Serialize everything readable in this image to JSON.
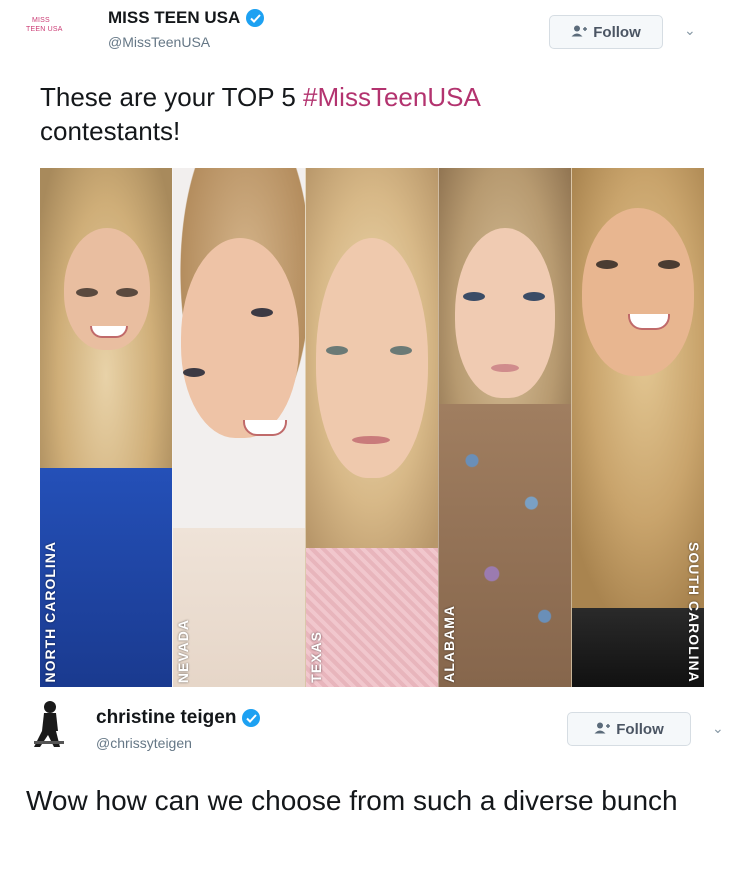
{
  "tweet1": {
    "logo_text": "MISS TEEN USA",
    "display_name": "MISS TEEN USA",
    "handle": "@MissTeenUSA",
    "follow_label": "Follow",
    "text_prefix": "These are your TOP 5 ",
    "hashtag": "#MissTeenUSA",
    "text_suffix": "contestants!"
  },
  "collage": {
    "panels": [
      {
        "state": "NORTH CAROLINA"
      },
      {
        "state": "NEVADA"
      },
      {
        "state": "TEXAS"
      },
      {
        "state": "ALABAMA"
      },
      {
        "state": "SOUTH CAROLINA"
      }
    ]
  },
  "tweet2": {
    "display_name": "christine teigen",
    "handle": "@chrissyteigen",
    "follow_label": "Follow",
    "text": "Wow how can we choose from such a diverse bunch"
  },
  "colors": {
    "verified": "#1da1f2",
    "hashtag": "#b3336f",
    "text": "#14171a",
    "handle": "#657786"
  }
}
